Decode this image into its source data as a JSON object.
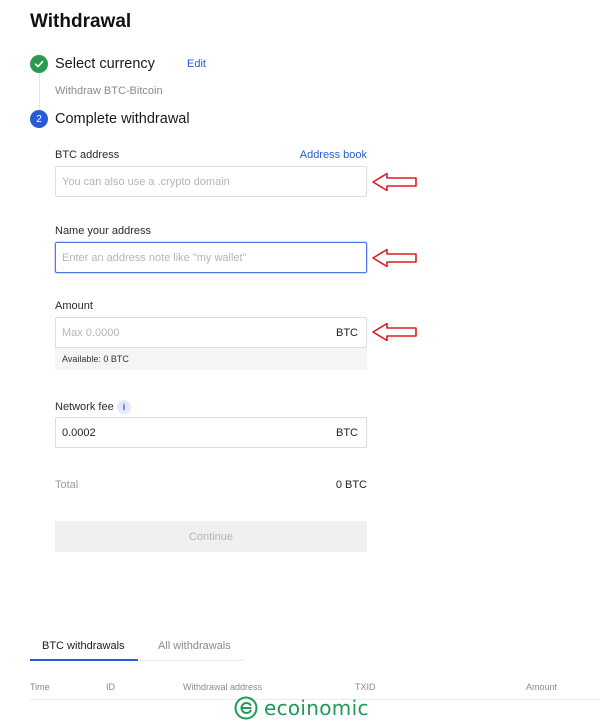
{
  "page": {
    "title": "Withdrawal"
  },
  "steps": [
    {
      "label": "Select currency",
      "status": "done",
      "edit_label": "Edit",
      "summary": "Withdraw BTC-Bitcoin"
    },
    {
      "number": "2",
      "label": "Complete withdrawal",
      "status": "active"
    }
  ],
  "form": {
    "address": {
      "label": "BTC address",
      "link": "Address book",
      "placeholder": "You can also use a .crypto domain"
    },
    "name": {
      "label": "Name your address",
      "placeholder": "Enter an address note like \"my wallet\""
    },
    "amount": {
      "label": "Amount",
      "placeholder": "Max 0.0000",
      "unit": "BTC",
      "available": "Available:  0 BTC"
    },
    "fee": {
      "label": "Network fee",
      "info_glyph": "i",
      "value": "0.0002",
      "unit": "BTC"
    },
    "total": {
      "label": "Total",
      "value": "0 BTC"
    },
    "continue_label": "Continue"
  },
  "history": {
    "tabs": [
      {
        "label": "BTC withdrawals",
        "active": true
      },
      {
        "label": "All withdrawals",
        "active": false
      }
    ],
    "columns": [
      "Time",
      "ID",
      "Withdrawal address",
      "TXID",
      "Amount"
    ]
  },
  "annotations": {
    "arrow_color": "#d92020"
  },
  "watermark": {
    "text": "ecoinomic",
    "color": "#1f9a5a"
  },
  "colors": {
    "accent": "#2a5bd7",
    "success": "#2b9a4f"
  }
}
